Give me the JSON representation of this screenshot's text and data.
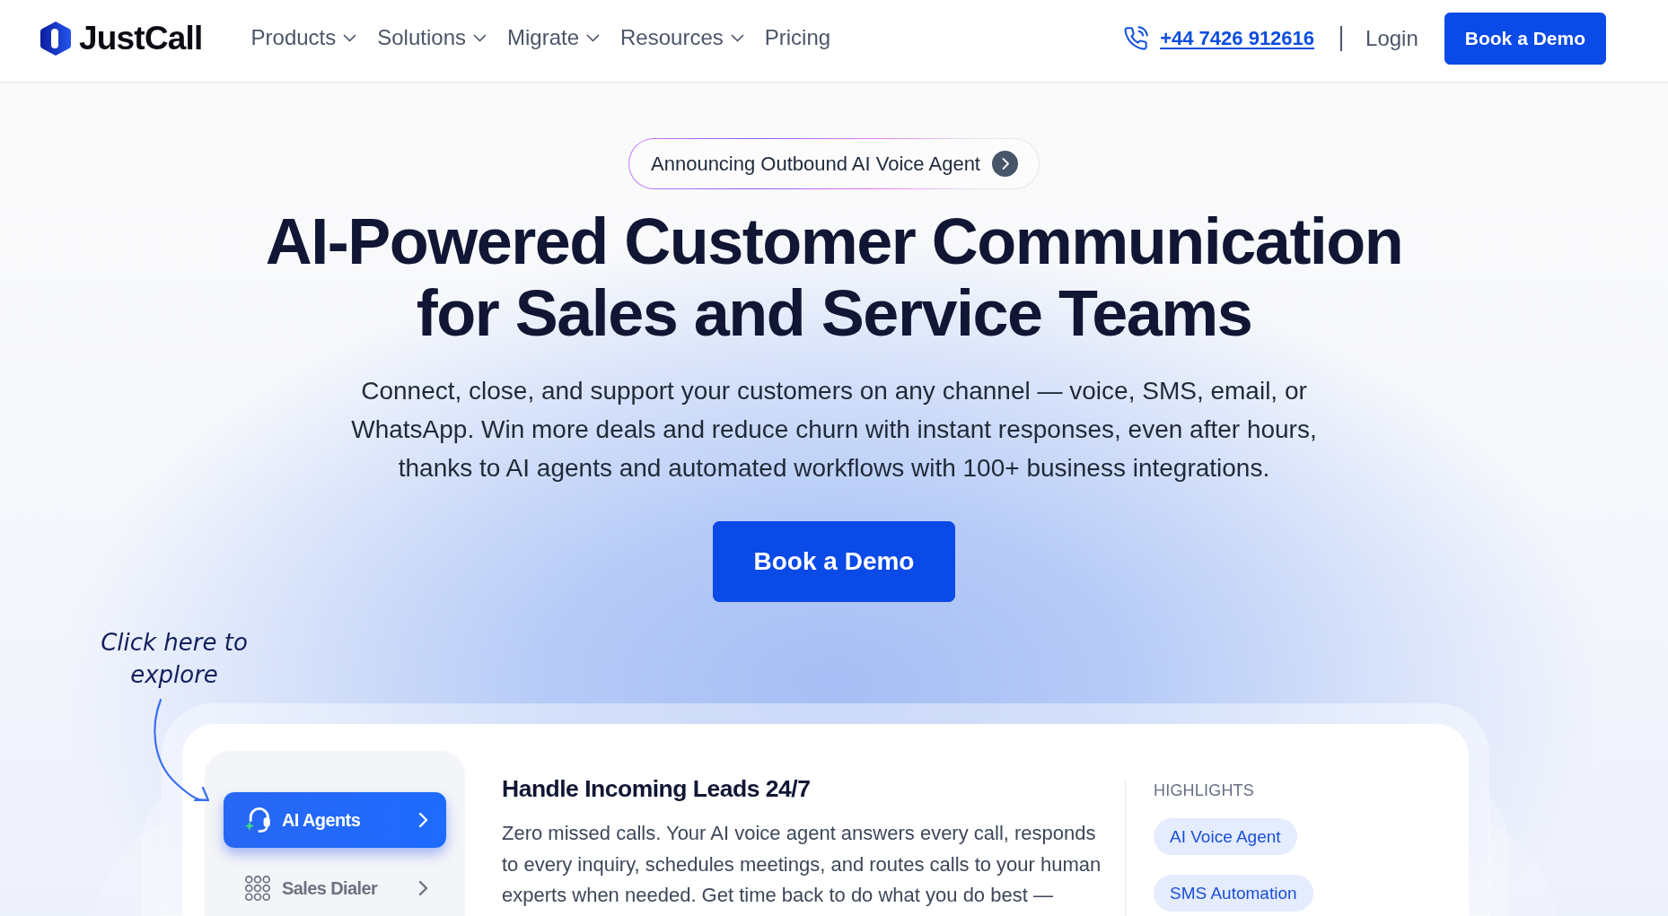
{
  "navbar": {
    "logo_text": "JustCall",
    "menu": [
      {
        "label": "Products",
        "dropdown": true
      },
      {
        "label": "Solutions",
        "dropdown": true
      },
      {
        "label": "Migrate",
        "dropdown": true
      },
      {
        "label": "Resources",
        "dropdown": true
      },
      {
        "label": "Pricing",
        "dropdown": false
      }
    ],
    "phone": "+44 7426 912616",
    "login": "Login",
    "cta": "Book a Demo"
  },
  "hero": {
    "announcement": "Announcing Outbound AI Voice Agent",
    "headline": "AI-Powered Customer Communication for Sales and Service Teams",
    "description": "Connect, close, and support your customers on any channel — voice, SMS, email, or WhatsApp. Win more deals and reduce churn with instant responses, even after hours, thanks to AI agents and automated workflows with 100+ business integrations.",
    "cta": "Book a Demo",
    "explore_hint": "Click here to explore"
  },
  "product_tour": {
    "tabs": [
      {
        "label": "AI Agents",
        "selected": true
      },
      {
        "label": "Sales Dialer",
        "selected": false
      }
    ],
    "title": "Handle Incoming Leads 24/7",
    "description": "Zero missed calls. Your AI voice agent answers every call, responds to every inquiry, schedules meetings, and routes calls to your human experts when needed. Get time back to do what you do best —",
    "highlights_heading": "HIGHLIGHTS",
    "highlights": [
      "AI Voice Agent",
      "SMS Automation"
    ]
  }
}
